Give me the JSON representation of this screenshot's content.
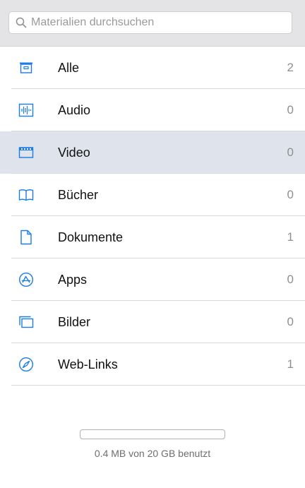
{
  "colors": {
    "accent": "#1a7ce5",
    "selected_row": "#dfe3ec",
    "count_text": "#8e8e93"
  },
  "search": {
    "placeholder": "Materialien durchsuchen",
    "value": "",
    "icon": "search-icon"
  },
  "categories": [
    {
      "label": "Alle",
      "count": "2",
      "icon": "archive-box-icon",
      "selected": false
    },
    {
      "label": "Audio",
      "count": "0",
      "icon": "audio-waveform-icon",
      "selected": false
    },
    {
      "label": "Video",
      "count": "0",
      "icon": "film-strip-icon",
      "selected": true
    },
    {
      "label": "Bücher",
      "count": "0",
      "icon": "open-book-icon",
      "selected": false
    },
    {
      "label": "Dokumente",
      "count": "1",
      "icon": "document-icon",
      "selected": false
    },
    {
      "label": "Apps",
      "count": "0",
      "icon": "app-store-icon",
      "selected": false
    },
    {
      "label": "Bilder",
      "count": "0",
      "icon": "stacked-pictures-icon",
      "selected": false
    },
    {
      "label": "Web-Links",
      "count": "1",
      "icon": "compass-icon",
      "selected": false
    }
  ],
  "storage": {
    "text": "0.4 MB von 20 GB benutzt",
    "used_fraction": 2e-05
  }
}
